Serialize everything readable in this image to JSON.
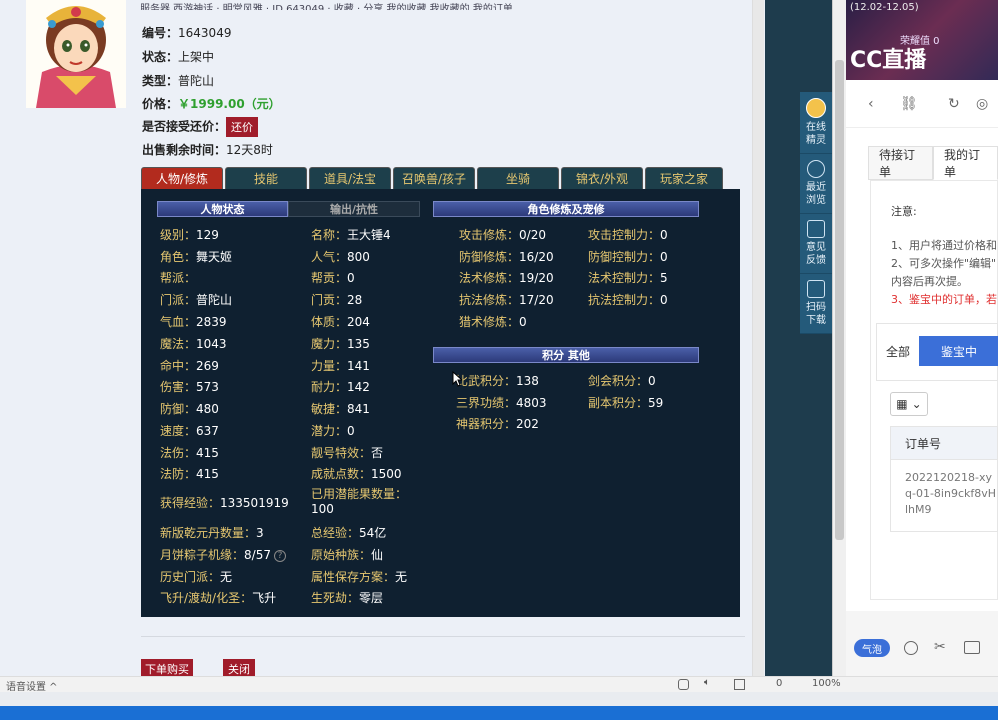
{
  "top_strip": "服务器  西游神话 · 明堂风雅  ·  ID 643049 ·  收藏 · 分享                 我的收藏   我收藏的   我的订单",
  "product": {
    "id_label": "编号：",
    "id_value": "1643049",
    "status_label": "状态：",
    "status_value": "上架中",
    "type_label": "类型：",
    "type_value": "普陀山",
    "price_label": "价格：",
    "price_value": "￥1999.00（元）",
    "counter_label": "是否接受还价：",
    "counter_button": "还价",
    "time_label": "出售剩余时间：",
    "time_value": "12天8时"
  },
  "tabs": [
    {
      "label": "人物/修炼",
      "active": true
    },
    {
      "label": "技能"
    },
    {
      "label": "道具/法宝"
    },
    {
      "label": "召唤兽/孩子"
    },
    {
      "label": "坐骑"
    },
    {
      "label": "锦衣/外观"
    },
    {
      "label": "玩家之家"
    }
  ],
  "sections": {
    "status": "人物状态",
    "output": "输出/抗性",
    "cultivation": "角色修炼及宠修",
    "score": "积分  其他"
  },
  "col1": [
    {
      "label": "级别：",
      "value": "129"
    },
    {
      "label": "角色：",
      "value": "舞天姬"
    },
    {
      "label": "帮派：",
      "value": ""
    },
    {
      "label": "门派：",
      "value": "普陀山"
    },
    {
      "label": "气血：",
      "value": "2839"
    },
    {
      "label": "魔法：",
      "value": "1043"
    },
    {
      "label": "命中：",
      "value": "269"
    },
    {
      "label": "伤害：",
      "value": "573"
    },
    {
      "label": "防御：",
      "value": "480"
    },
    {
      "label": "速度：",
      "value": "637"
    },
    {
      "label": "法伤：",
      "value": "415"
    },
    {
      "label": "法防：",
      "value": "415"
    },
    {
      "label": "获得经验：",
      "value": "133501919"
    },
    {
      "label": "新版乾元丹数量：",
      "value": "3"
    },
    {
      "label": "月饼粽子机缘：",
      "value": "8/57"
    },
    {
      "label": "历史门派：",
      "value": "无"
    },
    {
      "label": "飞升/渡劫/化圣：",
      "value": "飞升"
    }
  ],
  "col2": [
    {
      "label": "名称：",
      "value": "王大锤4"
    },
    {
      "label": "人气：",
      "value": "800"
    },
    {
      "label": "帮贡：",
      "value": "0"
    },
    {
      "label": "门贡：",
      "value": "28"
    },
    {
      "label": "体质：",
      "value": "204"
    },
    {
      "label": "魔力：",
      "value": "135"
    },
    {
      "label": "力量：",
      "value": "141"
    },
    {
      "label": "耐力：",
      "value": "142"
    },
    {
      "label": "敏捷：",
      "value": "841"
    },
    {
      "label": "潜力：",
      "value": "0"
    },
    {
      "label": "靓号特效：",
      "value": "否"
    },
    {
      "label": "成就点数：",
      "value": "1500"
    },
    {
      "label": "已用潜能果数量：",
      "value": "100"
    },
    {
      "label": "总经验：",
      "value": "54亿"
    },
    {
      "label": "原始种族：",
      "value": "仙"
    },
    {
      "label": "属性保存方案：",
      "value": "无"
    },
    {
      "label": "生死劫：",
      "value": "零层"
    }
  ],
  "cultivation": [
    {
      "label": "攻击修炼：",
      "value": "0/20"
    },
    {
      "label": "攻击控制力：",
      "value": "0"
    },
    {
      "label": "防御修炼：",
      "value": "16/20"
    },
    {
      "label": "防御控制力：",
      "value": "0"
    },
    {
      "label": "法术修炼：",
      "value": "19/20"
    },
    {
      "label": "法术控制力：",
      "value": "5"
    },
    {
      "label": "抗法修炼：",
      "value": "17/20"
    },
    {
      "label": "抗法控制力：",
      "value": "0"
    },
    {
      "label": "猎术修炼：",
      "value": "0"
    }
  ],
  "scores": [
    {
      "label": "比武积分：",
      "value": "138"
    },
    {
      "label": "剑会积分：",
      "value": "0"
    },
    {
      "label": "三界功绩：",
      "value": "4803"
    },
    {
      "label": "副本积分：",
      "value": "59"
    },
    {
      "label": "神器积分：",
      "value": "202"
    }
  ],
  "buttons": {
    "buy": "下单购买",
    "close": "关闭"
  },
  "sidebar": [
    {
      "label": "在线\n精灵"
    },
    {
      "label": "最近\n浏览"
    },
    {
      "label": "意见\n反馈"
    },
    {
      "label": "扫码\n下载"
    }
  ],
  "right": {
    "banner_date": "(12.02-12.05)",
    "banner_points": "荣耀值 0",
    "banner_logo": "CC直播",
    "order_tabs": [
      "待接订单",
      "我的订单"
    ],
    "notice_title": "注意:",
    "notice_lines": [
      "1、用户将通过价格和",
      "2、可多次操作\"编辑\"",
      "内容后再次提。",
      "3、鉴宝中的订单，若"
    ],
    "filter_all": "全部",
    "filter_active": "鉴宝中",
    "table_header": "订单号",
    "order_number": "2022120218-xyq-01-8in9ckf8vHlhM9",
    "bubble": "气泡"
  },
  "statusbar": {
    "zoom": "100%",
    "count": "0",
    "left": "语音设置 ^"
  }
}
